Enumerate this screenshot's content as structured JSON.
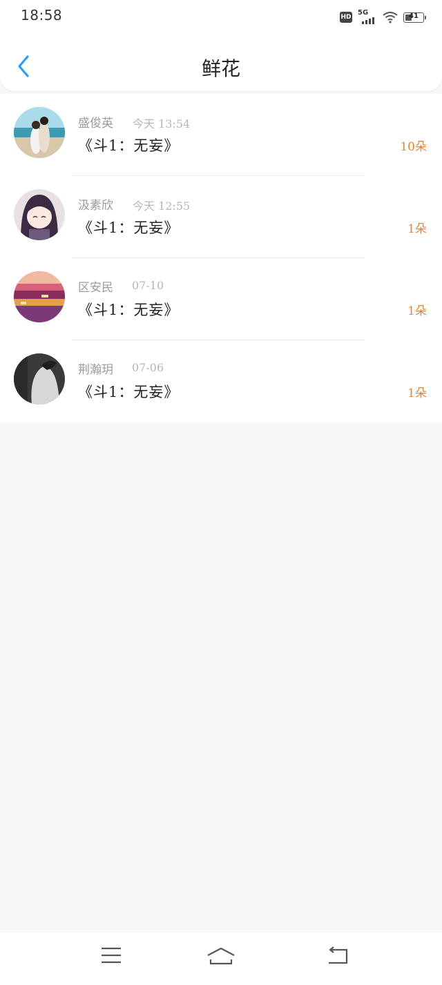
{
  "status_bar": {
    "time": "18:58",
    "hd_label": "HD",
    "network_label": "5G",
    "battery_level": "41",
    "battery_fraction": 0.41
  },
  "header": {
    "title": "鲜花",
    "back_icon": "chevron-left-icon",
    "accent_color": "#2a9df4"
  },
  "list": {
    "items": [
      {
        "name": "盛俊英",
        "time": "今天 13:54",
        "book": "《斗1：无妄》",
        "count": "10朵"
      },
      {
        "name": "汲素欣",
        "time": "今天 12:55",
        "book": "《斗1：无妄》",
        "count": "1朵"
      },
      {
        "name": "区安民",
        "time": "07-10",
        "book": "《斗1：无妄》",
        "count": "1朵"
      },
      {
        "name": "荆瀚玥",
        "time": "07-06",
        "book": "《斗1：无妄》",
        "count": "1朵"
      }
    ],
    "count_color": "#e0863c"
  },
  "system_nav": {
    "menu_icon": "menu-icon",
    "home_icon": "home-icon",
    "back_icon": "back-icon"
  }
}
